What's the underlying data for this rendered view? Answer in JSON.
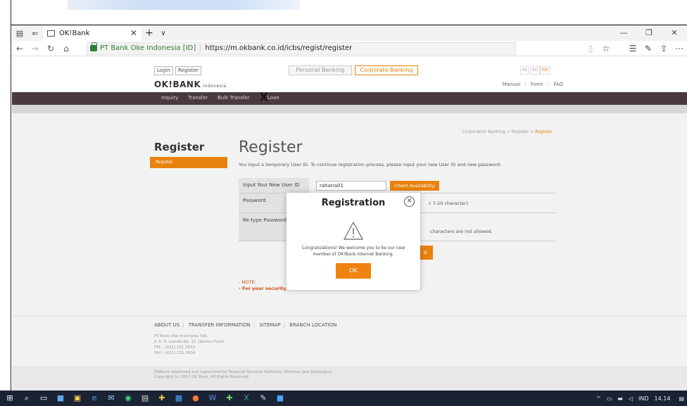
{
  "browser": {
    "tab_title": "OK!Bank",
    "new_tab": "+",
    "tab_list": "∨",
    "site_identity": "PT Bank Oke Indonesia [ID]",
    "url": "https://m.okbank.co.id/icbs/regist/register"
  },
  "header": {
    "login": "Login",
    "register": "Register",
    "personal_banking": "Personal Banking",
    "corporate_banking": "Corporate Banking",
    "languages": [
      "IN",
      "KO",
      "EN"
    ],
    "logo_text": "OK!BANK",
    "logo_sub": "Indonesia",
    "util_links": [
      "Manual",
      "Form",
      "FAQ"
    ]
  },
  "nav": {
    "items": [
      "Inquiry",
      "Transfer",
      "Bulk Transfer",
      "Loan"
    ]
  },
  "breadcrumb": {
    "parts": [
      "Corporation Banking",
      "Register"
    ],
    "current": "Register"
  },
  "sidebar": {
    "title": "Register",
    "active_item": "Register"
  },
  "main": {
    "title": "Register",
    "description": "You input a temporary User ID. To continue registration process, please input your new User ID and new password.",
    "fields": [
      {
        "label": "Input Your New User ID",
        "value": "raharia01",
        "button": "Check Availability"
      },
      {
        "label": "Password",
        "hint": "c 7-20 character)"
      },
      {
        "label": "Re-type Password",
        "hint": "characters are not allowed."
      }
    ],
    "submit_fragment": "d",
    "note_title": "- NOTE:",
    "note_text": "- For your security, d",
    "note_tail": ")"
  },
  "footer": {
    "links": [
      "ABOUT US",
      "TRANSFER INFORMATION",
      "SITEMAP",
      "BRANCH LOCATION"
    ],
    "address": [
      "PT Bank Oke Indonesia Tbk.",
      "Jl. Ir. H. Juanda No. 12, Jakarta Pusat",
      "TEL : (021) 231 2633",
      "FAX : (021) 231 2604"
    ],
    "regulation": "OKBank registered and supervised by Financial Services Authority (Otoritas Jasa Keuangan).",
    "copyright": "Copyright (c) 2017 OK Bank. All Rights Reserved."
  },
  "modal": {
    "title": "Registration",
    "message_line1": "Congratulations! We welcome you to be our new",
    "message_line2": "member of OK!Bank Internet Banking.",
    "ok_label": "OK"
  },
  "taskbar": {
    "language": "IND",
    "time": "14.14"
  },
  "colors": {
    "accent_orange": "#e8820e",
    "nav_dark": "#4a3a3f",
    "secure_green": "#2e7d32",
    "taskbar": "#1a2234"
  }
}
